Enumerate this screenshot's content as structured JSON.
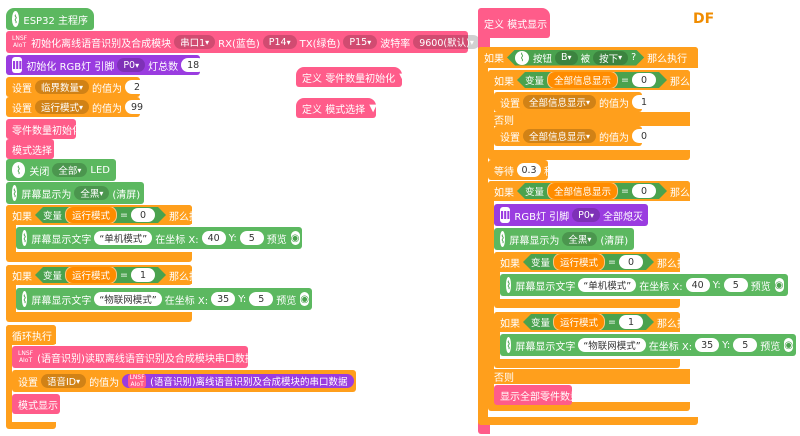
{
  "left": {
    "hat": "ESP32 主程序",
    "init_voice": {
      "label": "初始化离线语音识别及合成模块",
      "port": "串口1",
      "rx_label": "RX(蓝色)",
      "rx": "P14",
      "tx_label": "TX(绿色)",
      "tx": "P15",
      "baud_label": "波特率",
      "baud": "9600(默认)"
    },
    "init_rgb": {
      "label": "初始化 RGB灯 引脚",
      "pin": "P0",
      "count_label": "灯总数",
      "count": "18"
    },
    "set1": {
      "pre": "设置",
      "var": "临界数量",
      "mid": "的值为",
      "val": "2"
    },
    "set2": {
      "pre": "设置",
      "var": "运行模式",
      "mid": "的值为",
      "val": "99"
    },
    "call1": "零件数量初始化",
    "call2": "模式选择",
    "led": {
      "label": "关闭",
      "target": "全部",
      "suffix": "LED"
    },
    "screen_clear": {
      "label": "屏幕显示为",
      "color": "全黑",
      "suffix": "(清屏)"
    },
    "if1": {
      "if": "如果",
      "var_label": "变量",
      "var": "运行模式",
      "eq": "=",
      "val": "0",
      "then": "那么执行",
      "body": {
        "label": "屏幕显示文字",
        "text": "单机模式",
        "at": "在坐标 X:",
        "x": "40",
        "y_label": "Y:",
        "y": "5",
        "preview": "预览"
      }
    },
    "if2": {
      "if": "如果",
      "var_label": "变量",
      "var": "运行模式",
      "eq": "=",
      "val": "1",
      "then": "那么执行",
      "body": {
        "label": "屏幕显示文字",
        "text": "物联网模式",
        "at": "在坐标 X:",
        "x": "35",
        "y_label": "Y:",
        "y": "5",
        "preview": "预览"
      }
    },
    "loop": {
      "label": "循环执行",
      "read": "(语音识别)读取离线语音识别及合成模块串口数据",
      "set": {
        "pre": "设置",
        "var": "语音ID",
        "mid": "的值为",
        "expr": "(语音识别)离线语音识别及合成模块的串口数据"
      },
      "call": "模式显示"
    }
  },
  "middle": {
    "def1": {
      "def": "定义",
      "name": "零件数量初始化"
    },
    "def2": {
      "def": "定义",
      "name": "模式选择"
    }
  },
  "right": {
    "watermark": "DF",
    "def": {
      "def": "定义",
      "name": "模式显示"
    },
    "if_btn": {
      "if": "如果",
      "btn_label": "按钮",
      "btn": "B",
      "by": "被",
      "action": "按下",
      "q": "?",
      "then": "那么执行"
    },
    "inner_if": {
      "if": "如果",
      "var_label": "变量",
      "var": "全部信息显示",
      "eq": "=",
      "val": "0",
      "then": "那么执行"
    },
    "inner_set1": {
      "pre": "设置",
      "var": "全部信息显示",
      "mid": "的值为",
      "val": "1"
    },
    "else1": "否则",
    "inner_set0": {
      "pre": "设置",
      "var": "全部信息显示",
      "mid": "的值为",
      "val": "0"
    },
    "wait": {
      "label": "等待",
      "val": "0.3",
      "unit": "秒"
    },
    "if_show": {
      "if": "如果",
      "var_label": "变量",
      "var": "全部信息显示",
      "eq": "=",
      "val": "0",
      "then": "那么执行"
    },
    "rgb_off": {
      "label": "RGB灯 引脚",
      "pin": "P0",
      "action": "全部熄灭"
    },
    "screen": {
      "label": "屏幕显示为",
      "color": "全黑",
      "suffix": "(清屏)"
    },
    "rif1": {
      "if": "如果",
      "var_label": "变量",
      "var": "运行模式",
      "eq": "=",
      "val": "0",
      "then": "那么执行",
      "body": {
        "label": "屏幕显示文字",
        "text": "单机模式",
        "at": "在坐标 X:",
        "x": "40",
        "y_label": "Y:",
        "y": "5",
        "preview": "预览"
      }
    },
    "rif2": {
      "if": "如果",
      "var_label": "变量",
      "var": "运行模式",
      "eq": "=",
      "val": "1",
      "then": "那么执行",
      "body": {
        "label": "屏幕显示文字",
        "text": "物联网模式",
        "at": "在坐标 X:",
        "x": "35",
        "y_label": "Y:",
        "y": "5",
        "preview": "预览"
      }
    },
    "else2": "否则",
    "show_all": "显示全部零件数量"
  }
}
